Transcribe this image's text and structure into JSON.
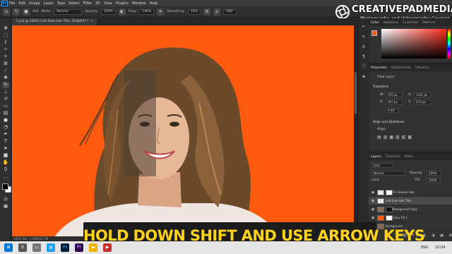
{
  "menu": [
    "File",
    "Edit",
    "Image",
    "Layer",
    "Type",
    "Select",
    "Filter",
    "3D",
    "View",
    "Plugins",
    "Window",
    "Help"
  ],
  "options": {
    "size_value": "200",
    "mode_label": "Mode:",
    "mode_value": "Normal",
    "opacity_label": "Opacity:",
    "opacity_value": "100%",
    "flow_label": "Flow:",
    "flow_value": "100%",
    "smoothing_label": "Smoothing:",
    "smoothing_value": "10%",
    "angle_value": "180°"
  },
  "document": {
    "tab_title": "7.psd @ 100% (Left Side Hair Thin, RGB/8#) *",
    "close_glyph": "×",
    "status": "100%   Doc: 2.64M/11.7M"
  },
  "watermark": {
    "brand": "CREATIVEPADMEDIA",
    "tagline": "Photography and Videography Courses"
  },
  "color_panel": {
    "tabs": [
      "Color",
      "Swatches",
      "Gradients",
      "Patterns"
    ],
    "foreground": "#f25a1a"
  },
  "properties": {
    "tabs": [
      "Properties",
      "Adjustments",
      "Libraries"
    ],
    "kind": "Pixel Layer",
    "transform_label": "Transform",
    "w_label": "W:",
    "w_value": "376 px",
    "h_label": "H:",
    "h_value": "497 px",
    "x_label": "X:",
    "x_value": "1331 px",
    "y_label": "Y:",
    "y_value": "276 px",
    "angle_value": "0.00°",
    "align_label": "Align and Distribute",
    "align_sub": "Align:"
  },
  "layers_panel": {
    "tabs": [
      "Layers",
      "Channels",
      "Paths"
    ],
    "kind_label": "Kind",
    "blend_mode": "Normal",
    "opacity_label": "Opacity:",
    "opacity_value": "100%",
    "lock_label": "Lock:",
    "fill_label": "Fill:",
    "fill_value": "100%",
    "layers": [
      {
        "name": "CS Volume Hair",
        "selected": false
      },
      {
        "name": "Left Side Hair Thin",
        "selected": true
      },
      {
        "name": "Background copy",
        "selected": false
      },
      {
        "name": "Color Fill 1",
        "selected": false
      },
      {
        "name": "Background",
        "selected": false
      }
    ]
  },
  "caption": "HOLD DOWN SHIFT AND USE ARROW KEYS",
  "taskbar": {
    "language": "ENG",
    "time": "10:09"
  },
  "colors": {
    "canvas_orange": "#ff5a0d",
    "caption_text": "#ffd21a",
    "caption_bg": "#1c1c1c"
  }
}
